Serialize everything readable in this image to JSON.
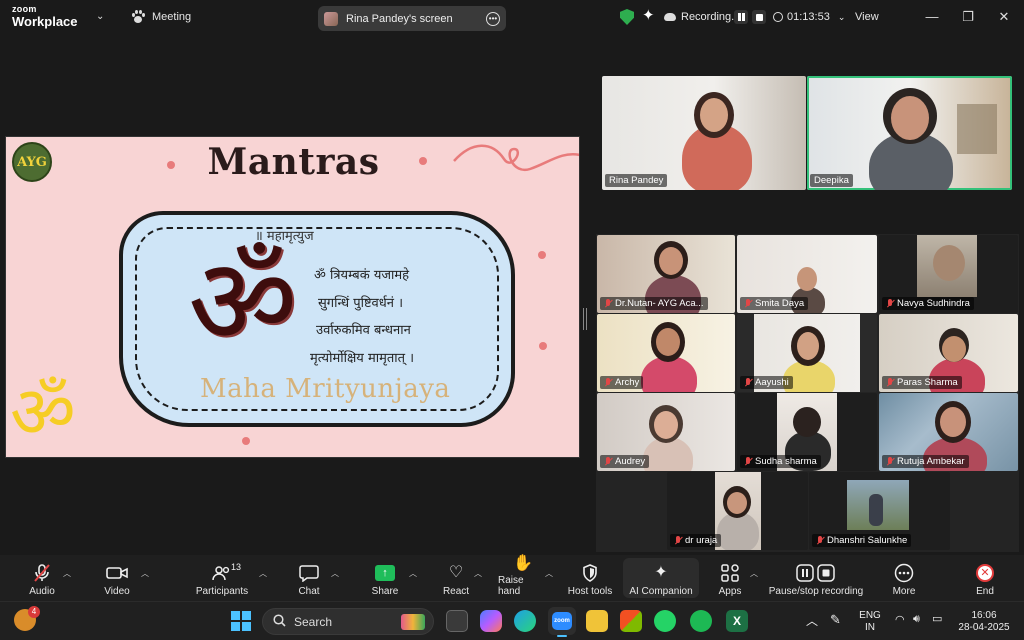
{
  "app": {
    "brand_top": "zoom",
    "brand_bottom": "Workplace",
    "meeting_label": "Meeting",
    "share_pill": "Rina Pandey's screen",
    "recording_label": "Recording...",
    "timer": "01:13:53",
    "view_label": "View"
  },
  "slide": {
    "logo_text": "AYG",
    "title": "Mantras",
    "verse_heading": "॥ महामृत्युज",
    "om_symbol": "ॐ",
    "lines": [
      "ॐ त्रियम्बकं यजामहे",
      "सुगन्धिं पुष्टिवर्धनं ।",
      "उर्वारुकमिव बन्धनान",
      "मृत्योर्मोक्षिय मामृतात् ।"
    ],
    "subtitle": "Maha Mrityunjaya"
  },
  "speakers": [
    {
      "name": "Rina Pandey"
    },
    {
      "name": "Deepika"
    }
  ],
  "gallery": [
    {
      "name": "Dr.Nutan- AYG Aca..."
    },
    {
      "name": "Smita Daya"
    },
    {
      "name": "Navya Sudhindra"
    },
    {
      "name": "Archy"
    },
    {
      "name": "Aayushi"
    },
    {
      "name": "Paras Sharma"
    },
    {
      "name": "Audrey"
    },
    {
      "name": "Sudha sharma"
    },
    {
      "name": "Rutuja Ambekar"
    },
    {
      "name": "dr uraja"
    },
    {
      "name": "Dhanshri Salunkhe"
    }
  ],
  "toolbar": {
    "audio": "Audio",
    "video": "Video",
    "participants": "Participants",
    "participants_count": "13",
    "chat": "Chat",
    "share": "Share",
    "react": "React",
    "raise_hand": "Raise hand",
    "host_tools": "Host tools",
    "ai_companion": "AI Companion",
    "apps": "Apps",
    "pause_stop": "Pause/stop recording",
    "more": "More",
    "end": "End"
  },
  "taskbar": {
    "badge": "4",
    "search_placeholder": "Search",
    "lang_top": "ENG",
    "lang_bottom": "IN",
    "time": "16:06",
    "date": "28-04-2025"
  },
  "colors": {
    "accent_green": "#34c17a",
    "share_green": "#1fbd5a",
    "end_red": "#e23b3b",
    "slide_bg": "#f8d4d4",
    "card_bg": "#cfe5f7"
  }
}
